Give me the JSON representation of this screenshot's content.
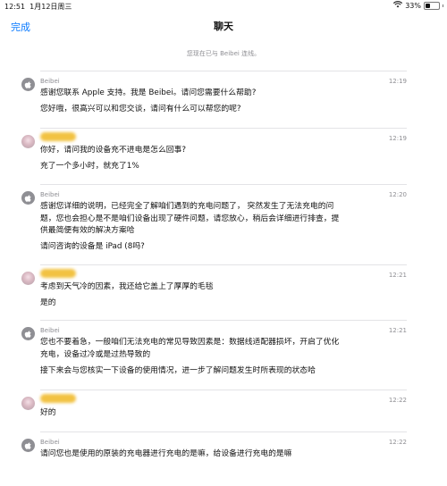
{
  "status": {
    "time": "12:51",
    "date": "1月12日周三",
    "battery": "33%"
  },
  "nav": {
    "done": "完成",
    "title": "聊天"
  },
  "connected": "您现在已与 Beibei 连线。",
  "messages": [
    {
      "sender": "Beibei",
      "time": "12:19",
      "lines": [
        "感谢您联系 Apple 支持。我是 Beibei。请问您需要什么帮助?",
        "您好哦，很高兴可以和您交谈，请问有什么可以帮您的呢?"
      ]
    },
    {
      "sender": "",
      "time": "12:19",
      "lines": [
        "你好，请问我的设备充不进电是怎么回事?",
        "充了一个多小时，就充了1%"
      ]
    },
    {
      "sender": "Beibei",
      "time": "12:20",
      "lines": [
        "感谢您详细的说明，已经完全了解咱们遇到的充电问题了，  突然发生了无法充电的问",
        "题，您也会担心是不是咱们设备出现了硬件问题，请您放心，稍后会详细进行排查，提",
        "供最简便有效的解决方案哈",
        "请问咨询的设备是 iPad (8吗?"
      ]
    },
    {
      "sender": "",
      "time": "12:21",
      "lines": [
        "考虑到天气冷的因素，我还给它盖上了厚厚的毛毯",
        "是的"
      ]
    },
    {
      "sender": "Beibei",
      "time": "12:21",
      "lines": [
        "您也不要着急，一般咱们无法充电的常见导致因素是：数据线适配器损坏，开启了优化",
        "充电，设备过冷或是过热导致的",
        "接下来会与您核实一下设备的使用情况，进一步了解问题发生时所表现的状态哈"
      ]
    },
    {
      "sender": "",
      "time": "12:22",
      "lines": [
        "好的"
      ]
    },
    {
      "sender": "Beibei",
      "time": "12:22",
      "lines": [
        "请问您也是使用的原装的充电器进行充电的是嘛，给设备进行充电的是嘛"
      ]
    }
  ]
}
